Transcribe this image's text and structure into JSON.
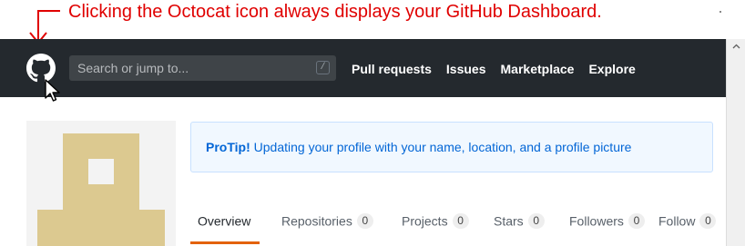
{
  "annotation": {
    "text": "Clicking the Octocat icon always displays your GitHub Dashboard.",
    "color": "#e00000"
  },
  "header": {
    "logo_icon": "octocat-icon",
    "search": {
      "placeholder": "Search or jump to...",
      "shortcut": "/"
    },
    "nav": [
      "Pull requests",
      "Issues",
      "Marketplace",
      "Explore"
    ]
  },
  "protip": {
    "bold": "ProTip!",
    "text": " Updating your profile with your name, location, and a profile picture"
  },
  "tabs": [
    {
      "label": "Overview",
      "active": true
    },
    {
      "label": "Repositories",
      "count": "0"
    },
    {
      "label": "Projects",
      "count": "0"
    },
    {
      "label": "Stars",
      "count": "0"
    },
    {
      "label": "Followers",
      "count": "0"
    },
    {
      "label": "Follow",
      "count": "0"
    }
  ],
  "colors": {
    "header_bg": "#24292e",
    "tab_accent": "#e36209",
    "identicon": "#dcc990",
    "protip_bg": "#f1f8ff",
    "link": "#0366d6"
  }
}
